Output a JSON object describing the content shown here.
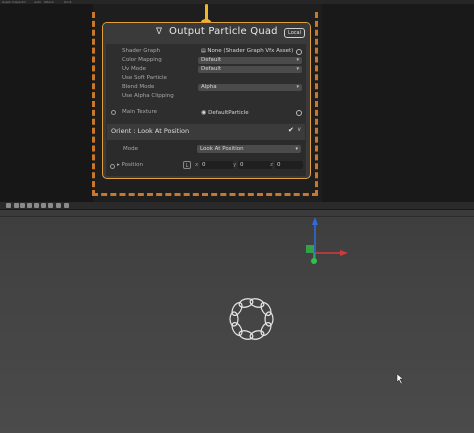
{
  "window": {
    "topbar_items": [
      "Graph Inspector",
      "Auto",
      "Attach",
      "Dock"
    ]
  },
  "node": {
    "title": "Output Particle Quad",
    "space_badge": "Local",
    "title_icon": "vfx-output-icon",
    "fields": [
      {
        "label": "Shader Graph",
        "value": "None (Shader Graph Vfx Asset)",
        "kind": "object"
      },
      {
        "label": "Color Mapping",
        "value": "Default",
        "kind": "dropdown"
      },
      {
        "label": "Uv Mode",
        "value": "Default",
        "kind": "dropdown"
      },
      {
        "label": "Use Soft Particle",
        "value": "",
        "kind": "toggle"
      },
      {
        "label": "Blend Mode",
        "value": "Alpha",
        "kind": "dropdown"
      },
      {
        "label": "Use Alpha Clipping",
        "value": "",
        "kind": "toggle"
      }
    ],
    "main_texture": {
      "label": "Main Texture",
      "value": "DefaultParticle"
    },
    "block": {
      "title": "Orient : Look At Position",
      "enabled": true,
      "mode_label": "Mode",
      "mode_value": "Look At Position",
      "position_label": "Position",
      "space_icon": "L",
      "x_label": "x",
      "x_value": "0",
      "y_label": "y",
      "y_value": "0",
      "z_label": "z",
      "z_value": "0"
    }
  },
  "colors": {
    "frame_dash": "#c8782d",
    "flow_wire": "#f0b52a",
    "node_border": "#e0a040",
    "gizmo_y": "#2d6cdf",
    "gizmo_x": "#d23a3a",
    "gizmo_z": "#2fc24a",
    "particle_ring": "#e6e6e6"
  }
}
